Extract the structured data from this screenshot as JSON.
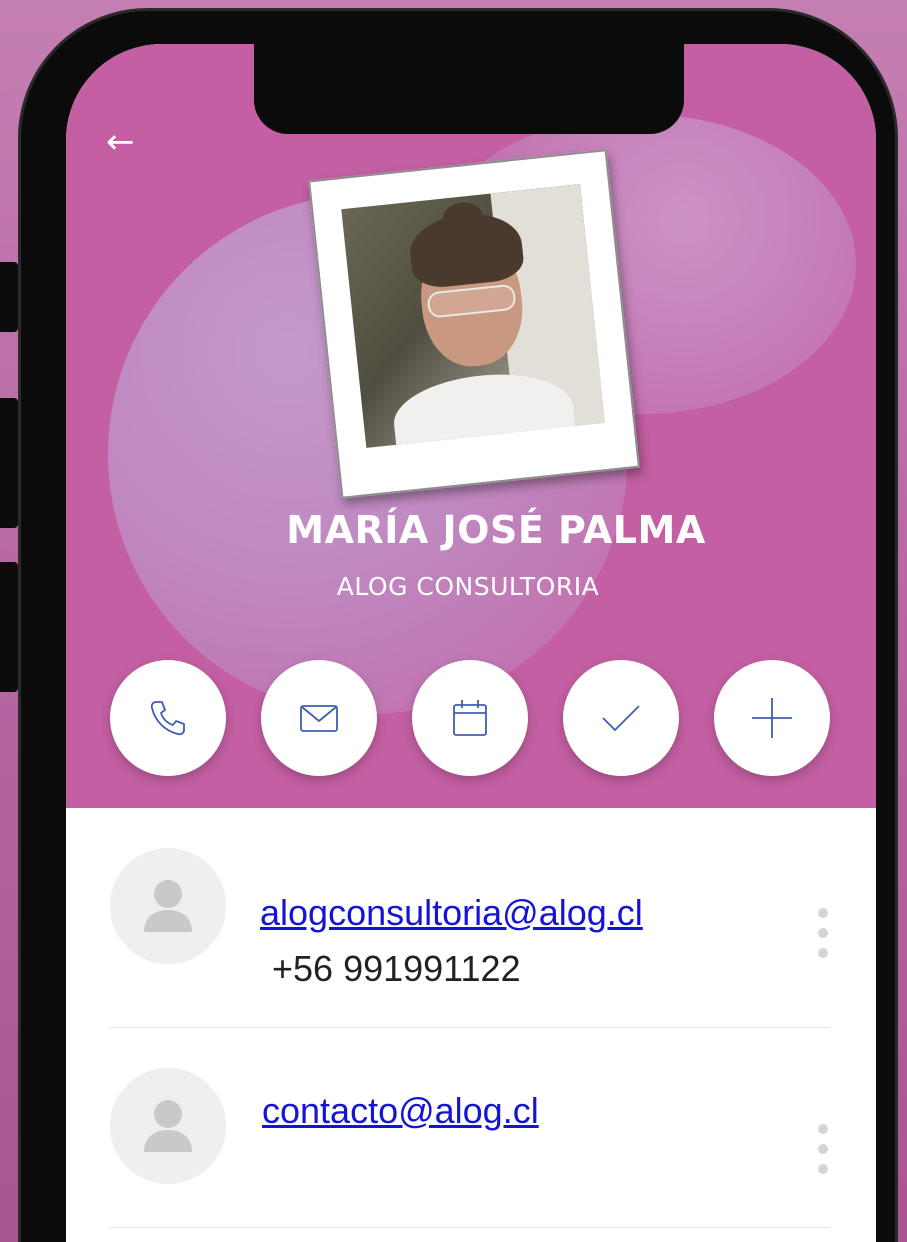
{
  "profile": {
    "name": "MARÍA JOSÉ PALMA",
    "company": "ALOG CONSULTORIA",
    "photo_alt": "profile-photo"
  },
  "header": {
    "back_icon": "arrow-left-icon",
    "back_glyph": "←",
    "background_color": "#c35fa2"
  },
  "actions": [
    {
      "icon": "phone-icon"
    },
    {
      "icon": "mail-icon"
    },
    {
      "icon": "calendar-icon"
    },
    {
      "icon": "check-icon"
    },
    {
      "icon": "plus-icon"
    }
  ],
  "contacts": [
    {
      "email": "alogconsultoria@alog.cl",
      "phone": "+56 991991122",
      "avatar_icon": "user-icon"
    },
    {
      "email": "contacto@alog.cl",
      "phone": "",
      "avatar_icon": "user-icon"
    }
  ],
  "colors": {
    "accent": "#c35fa2",
    "link": "#1414d6",
    "icon_stroke": "#3f5fb0"
  }
}
